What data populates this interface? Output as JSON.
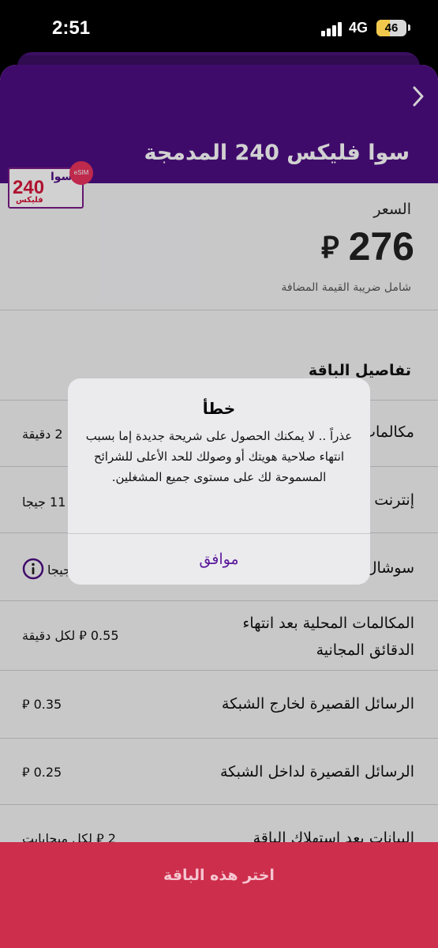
{
  "status_bar": {
    "time": "2:51",
    "network": "4G",
    "battery": "46",
    "battery_level": 0.46
  },
  "plan": {
    "title": "سوا فليكس 240 المدمجة",
    "logo": {
      "brand": "سوا",
      "number": "240",
      "sub": "فليكس",
      "badge": "eSIM"
    },
    "price_label": "السعر",
    "price_value": "276",
    "currency_symbol": "⃁",
    "vat_note": "شامل ضريبة القيمة المضافة"
  },
  "details": {
    "title": "تفاصيل الباقة",
    "rows": [
      {
        "label": "مكالمات",
        "value": "2 دقيقة"
      },
      {
        "label": "إنترنت",
        "value": "11 جيجا"
      },
      {
        "label": "سوشال",
        "value": "جيجا"
      },
      {
        "label": "المكالمات المحلية بعد انتهاء الدقائق المجانية",
        "value": "0.55 ⃁ لكل دقيقة"
      },
      {
        "label": "الرسائل القصيرة لخارج الشبكة",
        "value": "0.35 ⃁"
      },
      {
        "label": "الرسائل القصيرة لداخل الشبكة",
        "value": "0.25 ⃁"
      },
      {
        "label": "البيانات بعد استهلاك الباقة",
        "value": "2 ⃁ لكل ميجابايت"
      }
    ]
  },
  "dialog": {
    "title": "خطأ",
    "message": "عذراً .. لا يمكنك الحصول على شريحة جديدة إما بسبب انتهاء صلاحية هويتك أو وصولك للحد الأعلى للشرائح المسموحة لك على مستوى جميع المشغلين.",
    "ok_label": "موافق"
  },
  "cta": {
    "label": "اختر هذه الباقة"
  },
  "colors": {
    "header": "#4e0e83",
    "cta": "#cd2e4c",
    "accent": "#5a189a"
  }
}
